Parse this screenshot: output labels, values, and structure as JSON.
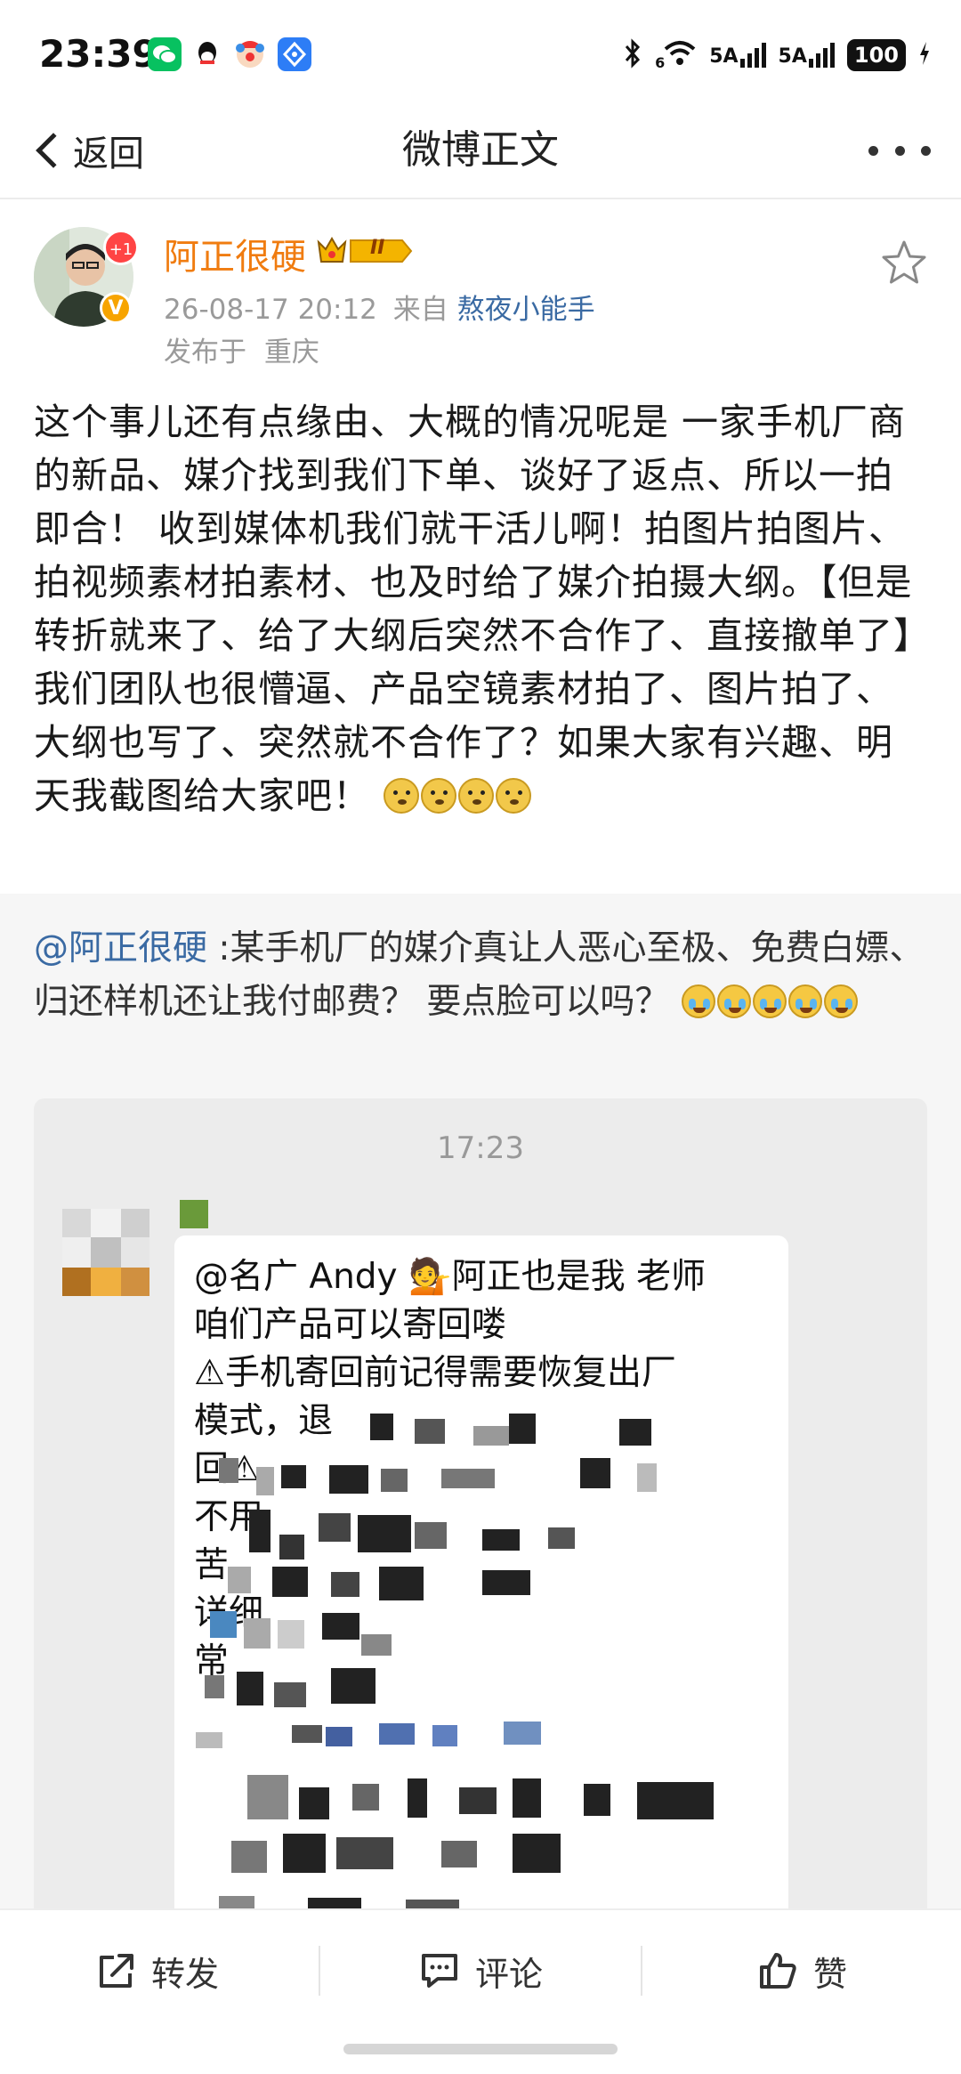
{
  "status_bar": {
    "time": "23:39",
    "signal_1": "5A",
    "signal_2": "5A",
    "wifi_tag": "6",
    "battery": "100",
    "icons": [
      "wechat-icon",
      "qq-icon",
      "clown-app-icon",
      "notification-app-icon",
      "bluetooth-icon",
      "wifi-icon",
      "charging-icon"
    ]
  },
  "nav": {
    "back_label": "返回",
    "title": "微博正文"
  },
  "post": {
    "author": "阿正很硬",
    "avatar_badge": "+1",
    "verified": "V",
    "level_badge": "II",
    "date": "26-08-17 20:12",
    "from_prefix": "来自",
    "source": "熬夜小能手",
    "location_prefix": "发布于",
    "location": "重庆",
    "text": "这个事儿还有点缘由、大概的情况呢是 一家手机厂商的新品、媒介找到我们下单、谈好了返点、所以一拍即合！ 收到媒体机我们就干活儿啊！拍图片拍图片、拍视频素材拍素材、也及时给了媒介拍摄大纲。【但是转折就来了、给了大纲后突然不合作了、直接撤单了】我们团队也很懵逼、产品空镜素材拍了、图片拍了、大纲也写了、突然就不合作了？如果大家有兴趣、明天我截图给大家吧！"
  },
  "repost": {
    "mention": "@阿正很硬",
    "text": ":某手机厂的媒介真让人恶心至极、免费白嫖、归还样机还让我付邮费？ 要点脸可以吗？"
  },
  "chat": {
    "time": "17:23",
    "lines": [
      "@名广 Andy 💁阿正也是我 老师",
      "咱们产品可以寄回喽",
      "⚠手机寄回前记得需要恢复出厂",
      "模式，退",
      "回⚠",
      "",
      "不用",
      "苦",
      "",
      "",
      "",
      "详细",
      "常"
    ]
  },
  "actions": {
    "repost": "转发",
    "comment": "评论",
    "like": "赞"
  },
  "colors": {
    "author_name": "#f07c10",
    "link": "#3a6aa3",
    "meta": "#9a9a9a",
    "repost_background": "#f6f6f6"
  }
}
